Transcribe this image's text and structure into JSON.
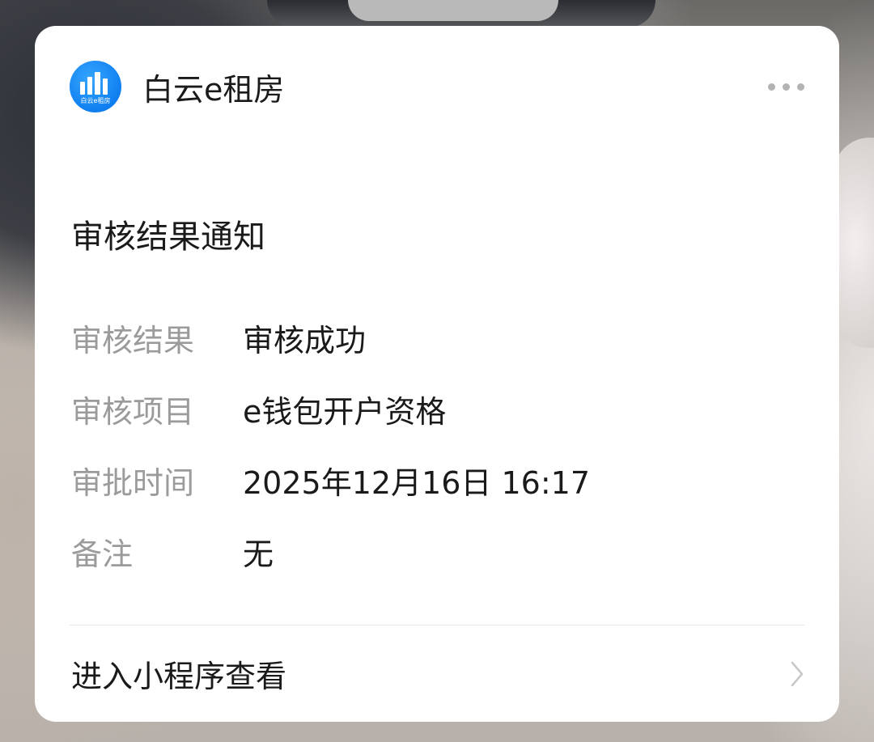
{
  "app": {
    "name": "白云e租房",
    "logo_text": "白云e租房",
    "accent_color": "#0f7ff0"
  },
  "notice": {
    "title": "审核结果通知",
    "fields": [
      {
        "label": "审核结果",
        "value": "审核成功"
      },
      {
        "label": "审核项目",
        "value": "e钱包开户资格"
      },
      {
        "label": "审批时间",
        "value": "2025年12月16日 16:17"
      },
      {
        "label": "备注",
        "value": "无"
      }
    ]
  },
  "footer": {
    "link_label": "进入小程序查看"
  },
  "icons": {
    "more": "more-horizontal-icon",
    "chevron": "chevron-right-icon",
    "logo": "building-logo-icon"
  }
}
